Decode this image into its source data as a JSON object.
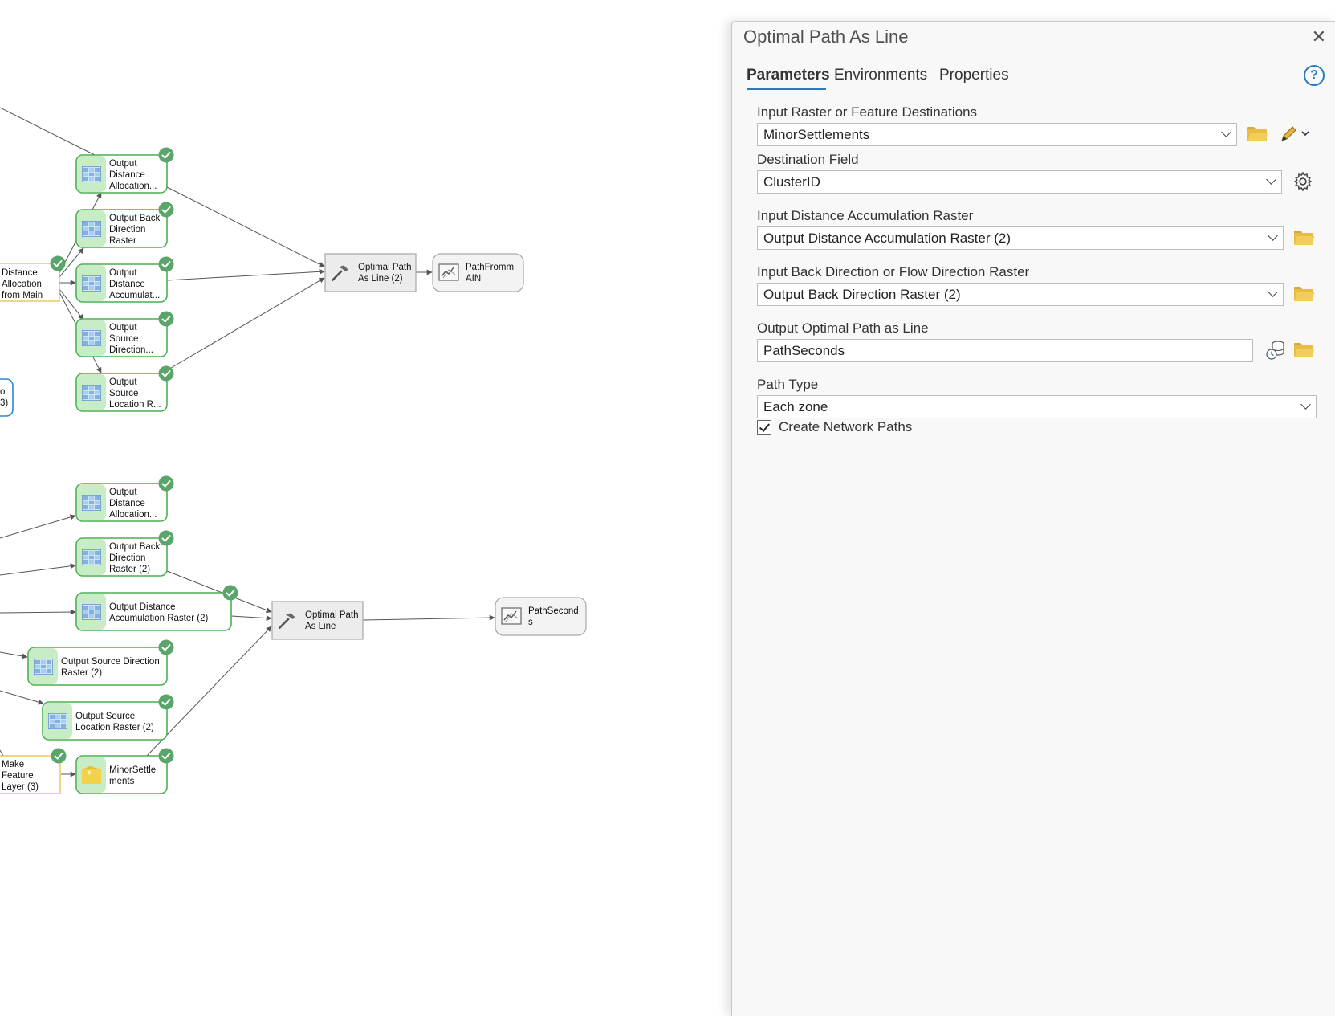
{
  "model": {
    "nodes": {
      "out_dist_alloc": "Output Distance Allocation...",
      "out_back_dir": "Output Back Direction Raster",
      "out_dist_accum": "Output Distance Accumulat...",
      "out_src_dir": "Output Source Direction...",
      "out_src_loc": "Output Source Location R...",
      "dist_alloc_tool": "Distance Allocation from Main",
      "partial_blue": "o 3)",
      "opt_path_2": "Optimal Path As Line (2)",
      "path_from_main": "PathFromm AIN",
      "out_dist_alloc_b": "Output Distance Allocation...",
      "out_back_dir_2": "Output Back Direction Raster (2)",
      "out_dist_accum_2": "Output Distance Accumulation Raster (2)",
      "out_src_dir_2": "Output Source Direction Raster (2)",
      "out_src_loc_2": "Output Source Location Raster (2)",
      "make_feature_layer": "Make Feature Layer (3)",
      "minor_settlements": "MinorSettle ments",
      "opt_path": "Optimal Path As Line",
      "path_seconds": "PathSecond s"
    },
    "colors": {
      "data_border": "#4caf50",
      "data_strip": "#c8ecc5",
      "tool_fill": "#ececec",
      "yellow_tool_border": "#e6c84a",
      "blue_tool_border": "#2f86d6",
      "check_badge": "#5aa56a"
    }
  },
  "panel": {
    "title": "Optimal Path As Line",
    "close_icon": "close-icon",
    "tabs": [
      "Parameters",
      "Environments",
      "Properties"
    ],
    "active_tab": "Parameters",
    "help_icon": "help-icon",
    "help_glyph": "?",
    "params": {
      "input_raster_label": "Input Raster or Feature Destinations",
      "input_raster_value": "MinorSettlements",
      "dest_field_label": "Destination Field",
      "dest_field_value": "ClusterID",
      "dist_accum_label": "Input Distance Accumulation Raster",
      "dist_accum_value": "Output Distance Accumulation Raster (2)",
      "back_dir_label": "Input Back Direction or Flow Direction Raster",
      "back_dir_value": "Output Back Direction Raster (2)",
      "out_path_label": "Output Optimal Path as Line",
      "out_path_value": "PathSeconds",
      "path_type_label": "Path Type",
      "path_type_value": "Each zone",
      "network_paths_label": "Create Network Paths",
      "network_paths_checked": true
    }
  }
}
